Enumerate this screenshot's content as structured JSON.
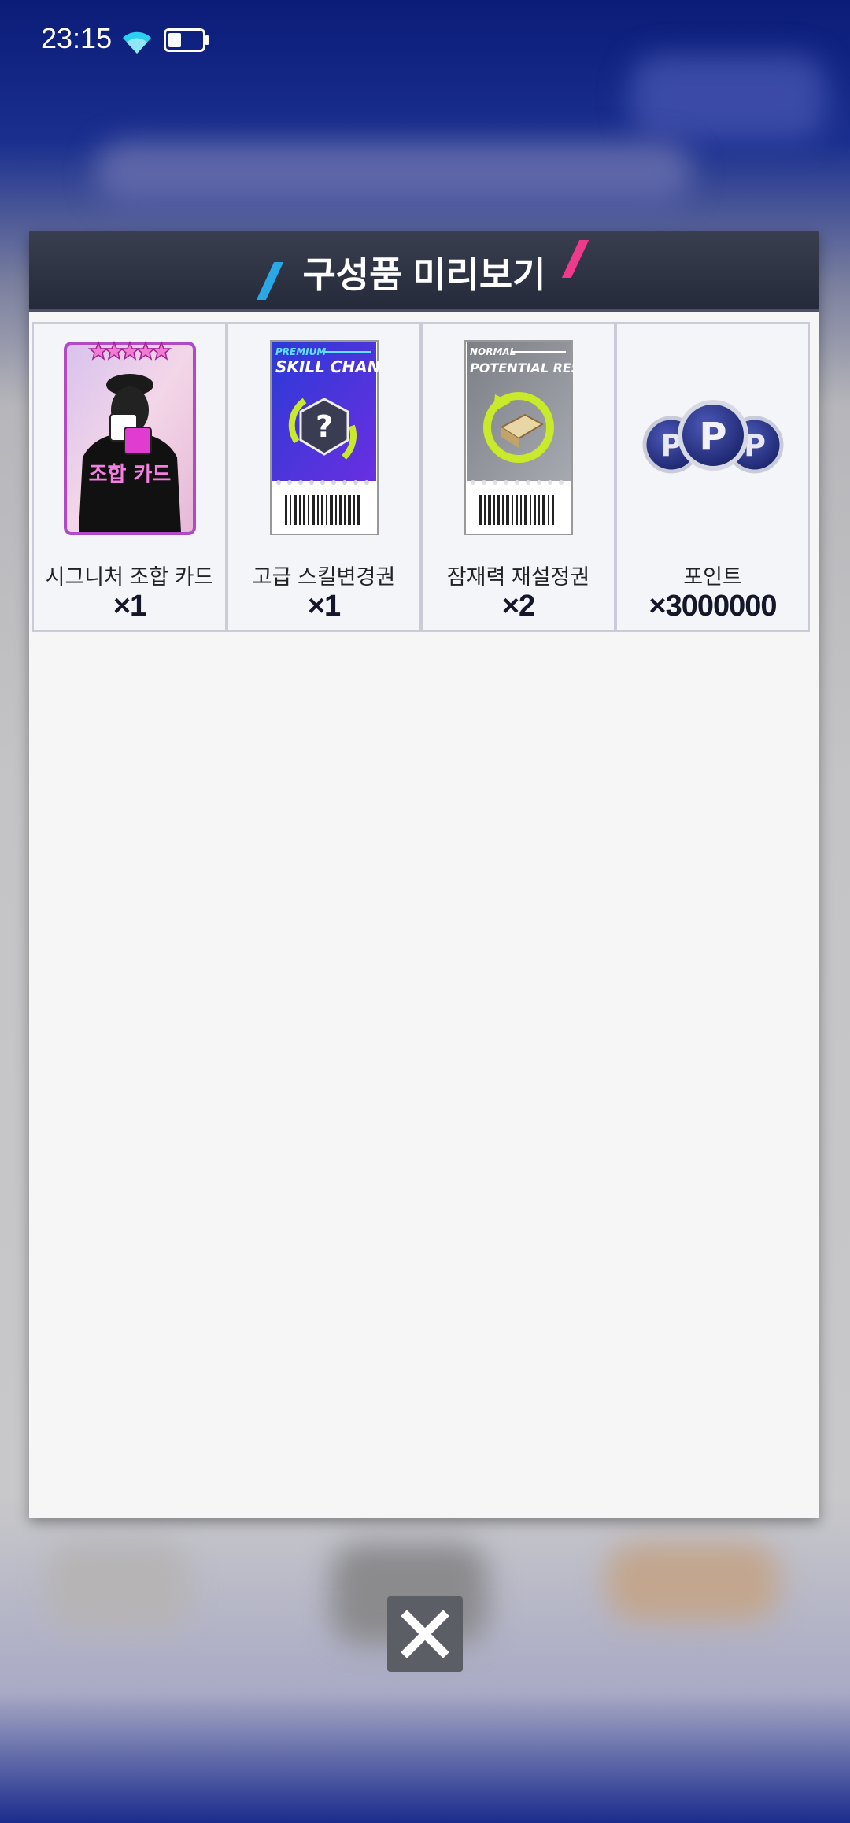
{
  "status_bar": {
    "time": "23:15"
  },
  "dialog": {
    "title": "구성품 미리보기",
    "items": [
      {
        "name": "시그니처 조합 카드",
        "quantity": "×1",
        "icon": "signature-combo-card-icon",
        "card_label": "조합 카드"
      },
      {
        "name": "고급 스킬변경권",
        "quantity": "×1",
        "icon": "premium-skill-change-ticket-icon",
        "ticket_top": "PREMIUM",
        "ticket_title": "SKILL CHANGE"
      },
      {
        "name": "잠재력 재설정권",
        "quantity": "×2",
        "icon": "normal-potential-reset-ticket-icon",
        "ticket_top": "NORMAL",
        "ticket_title": "POTENTIAL RESET"
      },
      {
        "name": "포인트",
        "quantity": "×3000000",
        "icon": "points-coins-icon"
      }
    ]
  },
  "colors": {
    "header_bg": "#2b3042",
    "accent_blue": "#2aa8e6",
    "accent_pink": "#ee3a8c",
    "panel_bg": "#f6f6f6"
  }
}
